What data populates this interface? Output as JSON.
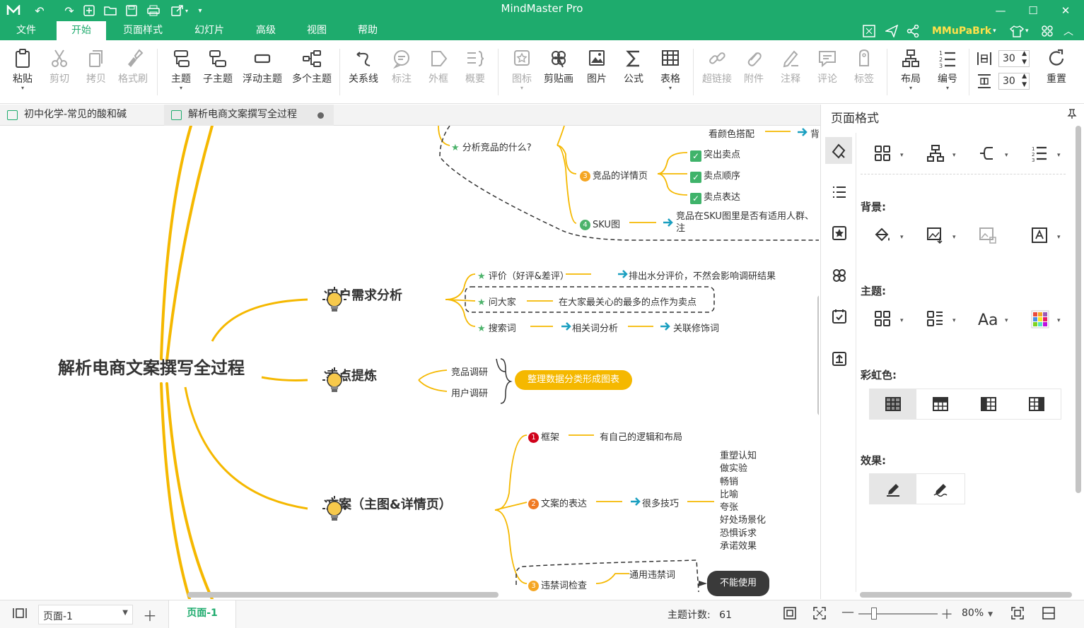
{
  "app": {
    "title": "MindMaster Pro",
    "user": "MMuPaBrk"
  },
  "menu": [
    "文件",
    "开始",
    "页面样式",
    "幻灯片",
    "高级",
    "视图",
    "帮助"
  ],
  "ribbon": {
    "paste": "粘贴",
    "cut": "剪切",
    "copy": "拷贝",
    "format_painter": "格式刷",
    "topic": "主题",
    "subtopic": "子主题",
    "floating_topic": "浮动主题",
    "multi_topic": "多个主题",
    "relationship": "关系线",
    "callout": "标注",
    "boundary": "外框",
    "summary": "概要",
    "icon": "图标",
    "clipart": "剪贴画",
    "picture": "图片",
    "formula": "公式",
    "table": "表格",
    "hyperlink": "超链接",
    "attachment": "附件",
    "note": "注释",
    "comment": "评论",
    "tag": "标签",
    "layout": "布局",
    "numbering": "编号",
    "reset": "重置",
    "spacing_h": "30",
    "spacing_v": "30"
  },
  "tabs": [
    {
      "label": "初中化学-常见的酸和碱"
    },
    {
      "label": "解析电商文案撰写全过程"
    }
  ],
  "mindmap": {
    "root": "解析电商文案撰写全过程",
    "top": {
      "color_match": "看颜色搭配",
      "color_match_tail": "背",
      "analyze": "分析竞品的什么?",
      "detail": "竞品的详情页",
      "detail_num": "3",
      "checks": [
        "突出卖点",
        "卖点顺序",
        "卖点表达"
      ],
      "sku": "SKU图",
      "sku_num": "4",
      "sku_note_1": "竞品在SKU图里是否有适用人群、",
      "sku_note_2": "注"
    },
    "demand": {
      "title": "用户需求分析",
      "items": [
        {
          "label": "评价（好评&差评）",
          "note": "排出水分评价，不然会影响调研结果"
        },
        {
          "label": "问大家",
          "note": "在大家最关心的最多的点作为卖点"
        },
        {
          "label": "搜索词",
          "note": "相关词分析",
          "note2": "关联修饰词"
        }
      ]
    },
    "selling": {
      "title": "卖点提炼",
      "items": [
        "竞品调研",
        "用户调研"
      ],
      "result": "整理数据分类形成图表"
    },
    "copy": {
      "title": "文案（主图&详情页）",
      "frame": "框架",
      "frame_num": "1",
      "frame_note": "有自己的逻辑和布局",
      "express": "文案的表达",
      "express_num": "2",
      "skills": "很多技巧",
      "skill_list": [
        "重塑认知",
        "做实验",
        "畅销",
        "比喻",
        "夸张",
        "好处场景化",
        "恐惧诉求",
        "承诺效果"
      ],
      "banned": "违禁词检查",
      "banned_num": "3",
      "banned_common": "通用违禁词",
      "banned_note": "不能使用"
    }
  },
  "panel": {
    "title": "页面格式",
    "background": "背景:",
    "theme": "主题:",
    "rainbow": "彩虹色:",
    "effect": "效果:"
  },
  "status": {
    "page_select": "页面-1",
    "page_tab": "页面-1",
    "topic_count_label": "主题计数:",
    "topic_count": "61",
    "zoom": "80%"
  },
  "colors": {
    "brand": "#1eab6d",
    "branch": "#f5b800",
    "arrow": "#1a9fc0",
    "star": "#4cb36b"
  }
}
